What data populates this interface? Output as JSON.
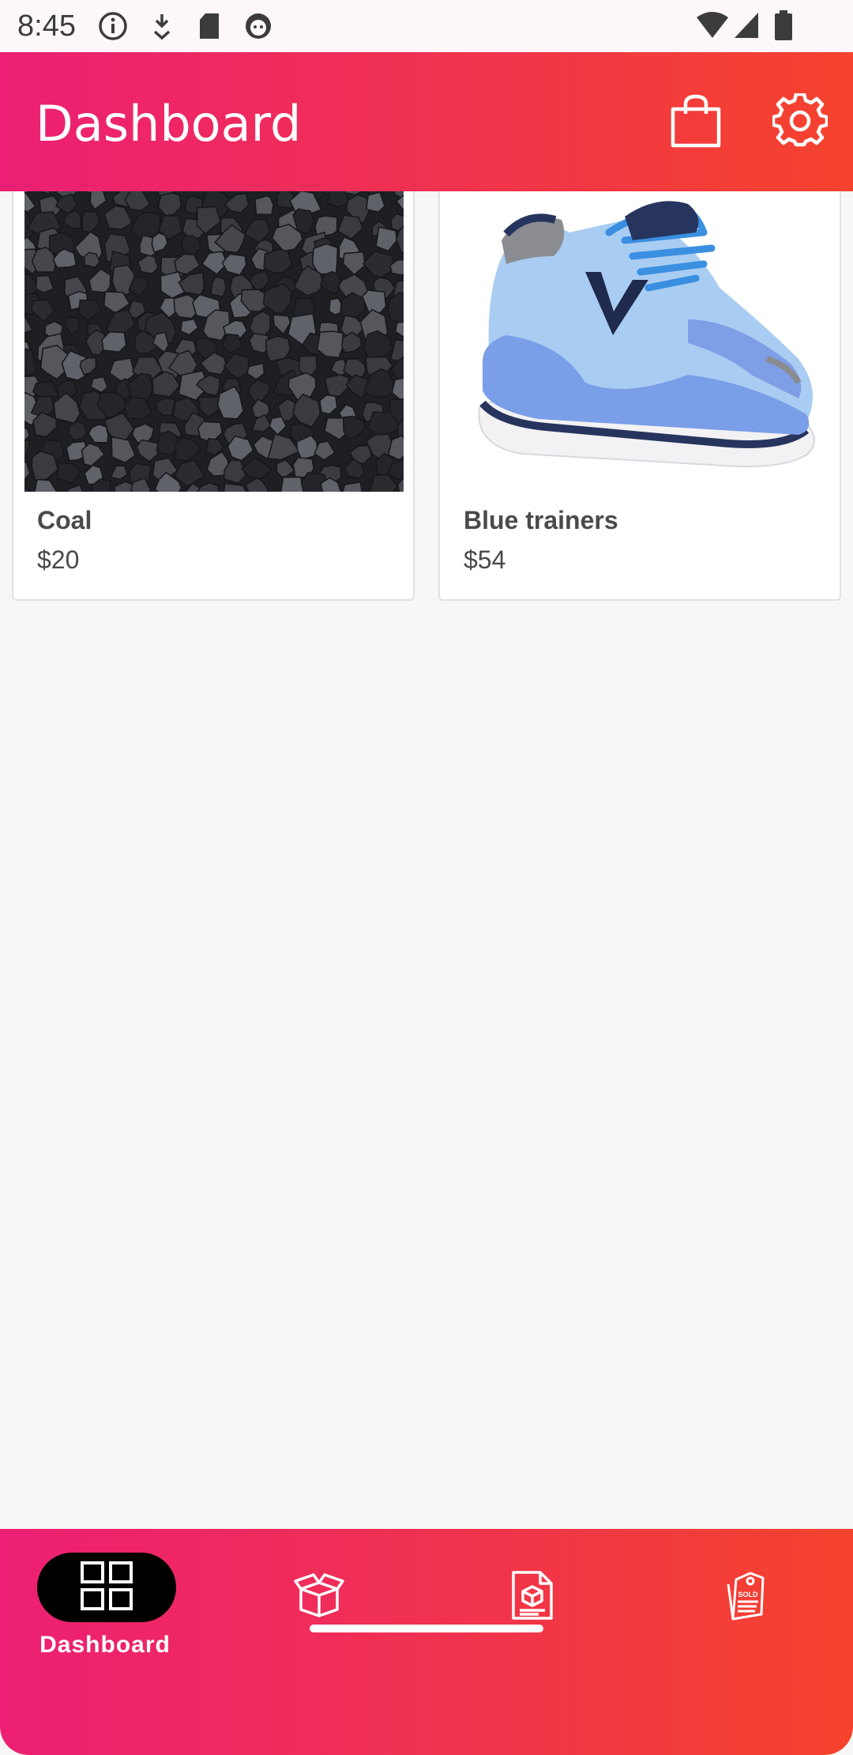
{
  "status_bar": {
    "time": "8:45",
    "left_icons": [
      "info-icon",
      "download-icon",
      "sd-card-icon",
      "cat-face-icon"
    ],
    "right_icons": [
      "wifi-icon",
      "cell-signal-icon",
      "battery-icon"
    ]
  },
  "app_bar": {
    "title": "Dashboard",
    "actions": [
      "shopping-bag-icon",
      "gear-icon"
    ],
    "gradient": [
      "#ec1f74",
      "#f5432d"
    ]
  },
  "products": [
    {
      "name": "Coal",
      "price": "$20",
      "image": "coal-image"
    },
    {
      "name": "Blue trainers",
      "price": "$54",
      "image": "blue-trainers-image"
    }
  ],
  "bottom_nav": {
    "items": [
      {
        "label": "Dashboard",
        "icon": "dashboard-grid-icon",
        "active": true
      },
      {
        "label": "",
        "icon": "box-icon",
        "active": false
      },
      {
        "label": "",
        "icon": "order-document-icon",
        "active": false
      },
      {
        "label": "",
        "icon": "sold-tag-icon",
        "active": false
      }
    ]
  }
}
